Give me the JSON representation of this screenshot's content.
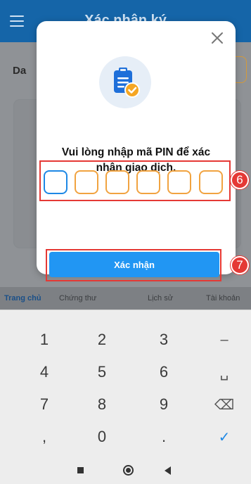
{
  "app": {
    "title": "Xác nhận ký",
    "behind_label": "Da"
  },
  "tabs": [
    {
      "label": "Trang chủ",
      "active": true
    },
    {
      "label": "Chứng thư",
      "active": false
    },
    {
      "label": "Lịch sử",
      "active": false
    },
    {
      "label": "Tài khoản",
      "active": false
    }
  ],
  "modal": {
    "prompt_line1": "Vui lòng nhập mã PIN để xác",
    "prompt_line2": "nhận giao dịch.",
    "pin_length": 6,
    "confirm_label": "Xác nhận",
    "step_pin": "6",
    "step_confirm": "7",
    "icon": "clipboard-check-icon"
  },
  "keyboard": {
    "rows": [
      [
        "1",
        "2",
        "3",
        "–"
      ],
      [
        "4",
        "5",
        "6",
        "␣"
      ],
      [
        "7",
        "8",
        "9",
        "⌫"
      ],
      [
        ",",
        "0",
        ".",
        "✓"
      ]
    ]
  },
  "colors": {
    "accent": "#2196f3",
    "highlight": "#e53935",
    "pin_border": "#f1a340",
    "header": "#1565a8"
  }
}
